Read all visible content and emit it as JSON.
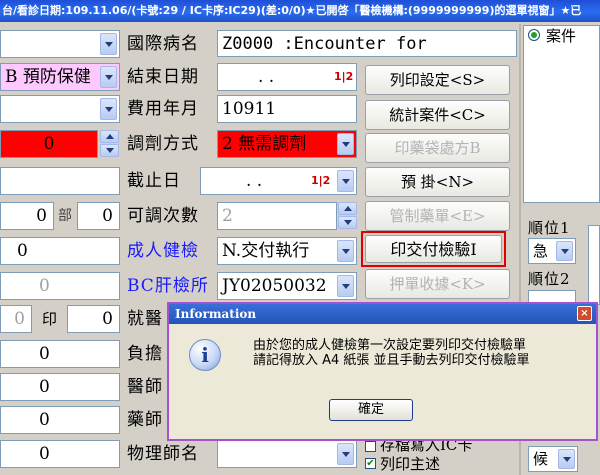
{
  "window": {
    "title": "台/看診日期:109.11.06/(卡號:29 / IC卡序:IC29)(差:0/0)★已開啓「醫檢機構:(9999999999)的選單視窗」★已"
  },
  "left": {
    "r1_value": "",
    "r2_value": "B 預防保健",
    "r3_value": "",
    "r4_value": "0",
    "r6_val1": "0",
    "r6_unit": "部",
    "r6_val2": "0",
    "r7_value": "0",
    "r8_value": "0",
    "r9_val1": "0",
    "r9_label": "印",
    "r9_val2": "0",
    "r10_value": "0",
    "r11_value": "0",
    "r12_value": "0",
    "r13_value": "0"
  },
  "mid": {
    "labels": [
      "國際病名",
      "結束日期",
      "費用年月",
      "調劑方式",
      "截止日",
      "可調次數",
      "成人健檢",
      "BC肝檢所",
      "就醫",
      "負擔",
      "醫師",
      "藥師",
      "物理師名"
    ],
    "diagnosis_value": "Z0000 :Encounter for",
    "end_date_value": ".    .",
    "cal_label": "1|2",
    "fee_month_value": "10911",
    "dispense_value": "2 無需調劑",
    "deadline_value": ".    .",
    "adjust_count_value": "2",
    "adult_check_value": "N.交付執行",
    "bc_liver_value": "JY02050032",
    "physio_value": ""
  },
  "buttons": {
    "print_setting": "列印設定<S>",
    "stats_case": "統計案件<C>",
    "bag_print": "印藥袋處方B",
    "reserve": "預  掛<N>",
    "control_drug": "管制藥單<E>",
    "print_checklist": "印交付檢驗I",
    "deposit_receipt": "押單收據<K>"
  },
  "right": {
    "case_label": "案件",
    "rank1_label": "順位1",
    "rank1_value": "急",
    "rank2_label": "順位2",
    "rank2_value": "",
    "rank_bottom_value": "候",
    "save_ic_label": "存檔寫入IC卡",
    "print_summary_label": "列印主述"
  },
  "dialog": {
    "title": "Information",
    "line1": "由於您的成人健檢第一次設定要列印交付檢驗單",
    "line2": "請記得放入 A4 紙張 並且手動去列印交付檢驗單",
    "ok_label": "確定",
    "close_glyph": "×",
    "icon_glyph": "i"
  },
  "colors": {
    "accent_red": "#ff0000",
    "pink": "#ffc8ff",
    "dialog_border": "#a552d0",
    "titlebar": "#2a6cf0"
  }
}
